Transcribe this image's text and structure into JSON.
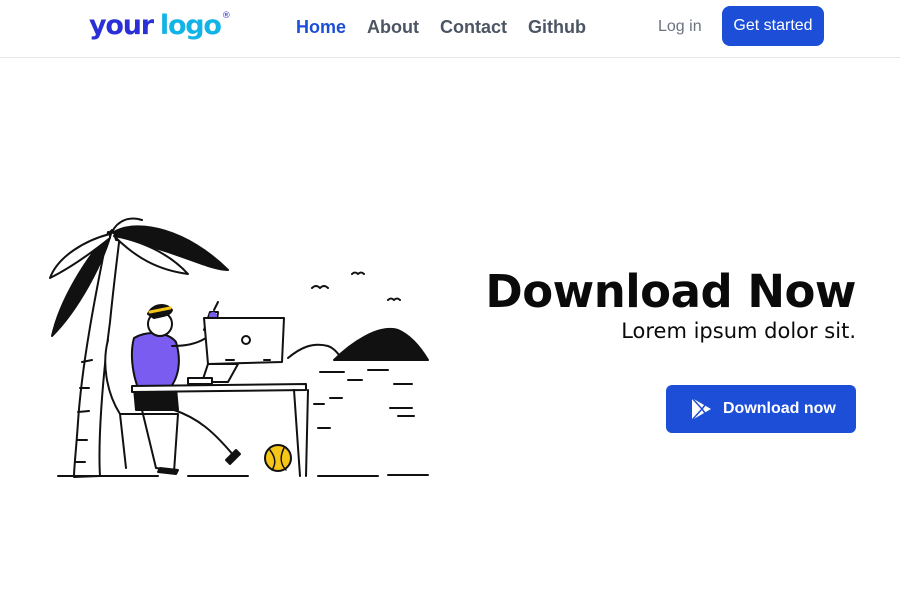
{
  "logo": {
    "word1": "your",
    "word2": "logo",
    "mark": "®"
  },
  "nav": {
    "items": [
      {
        "label": "Home",
        "active": true
      },
      {
        "label": "About",
        "active": false
      },
      {
        "label": "Contact",
        "active": false
      },
      {
        "label": "Github",
        "active": false
      }
    ],
    "login_label": "Log in",
    "cta_label": "Get started"
  },
  "hero": {
    "title": "Download Now",
    "subtitle": "Lorem ipsum dolor sit.",
    "button_label": "Download now",
    "button_icon": "play-store-icon"
  },
  "colors": {
    "primary": "#1d4ed8",
    "logo_dark": "#2a2fd6",
    "logo_light": "#12b3e6",
    "nav_text": "#4b5563",
    "accent_purple": "#7a5cf0",
    "accent_yellow": "#f5c518"
  }
}
